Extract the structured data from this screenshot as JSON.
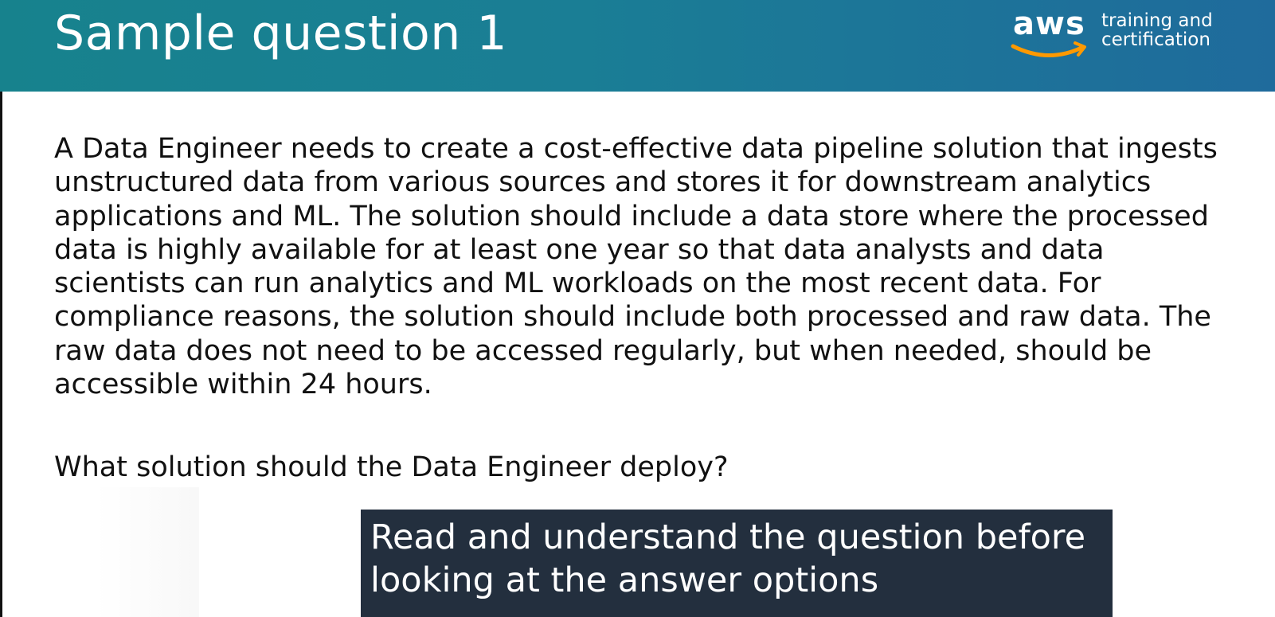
{
  "slide": {
    "title": "Sample question 1",
    "logo": {
      "brand": "aws",
      "tagline_line1": "training and",
      "tagline_line2": "certification",
      "smile_color": "#ff9900"
    },
    "question_body": "A Data Engineer needs to create a cost-effective data pipeline solution that ingests unstructured data from various sources and stores it for downstream analytics applications and ML. The solution should include a data store where the processed data is highly available for at least one year so that data analysts and data scientists can run analytics and ML workloads on the most recent data. For compliance reasons, the solution should include both processed and raw data. The raw data does not need to be accessed regularly, but when needed, should be accessible within 24 hours.",
    "question_prompt": "What solution should the Data Engineer deploy?"
  },
  "caption": {
    "line1": "Read and understand the question before",
    "line2": "looking at the answer options"
  },
  "colors": {
    "header_start": "#17828d",
    "header_end": "#1f6b9c",
    "caption_bg": "#232f3e",
    "text": "#111111"
  }
}
